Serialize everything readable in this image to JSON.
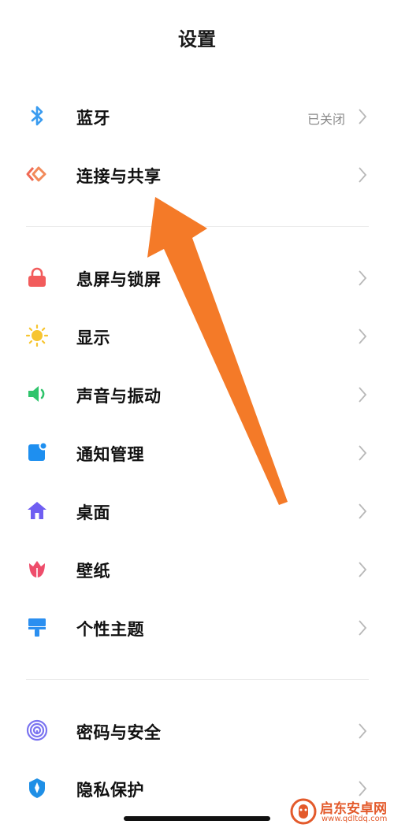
{
  "header": {
    "title": "设置"
  },
  "sections": [
    [
      {
        "id": "bluetooth",
        "label": "蓝牙",
        "value": "已关闭",
        "icon": "bluetooth-icon",
        "color": "#3a9cf0"
      },
      {
        "id": "connection",
        "label": "连接与共享",
        "value": "",
        "icon": "connection-share-icon",
        "color": "#f06a55"
      }
    ],
    [
      {
        "id": "lockscreen",
        "label": "息屏与锁屏",
        "value": "",
        "icon": "lock-icon",
        "color": "#f25c5c"
      },
      {
        "id": "display",
        "label": "显示",
        "value": "",
        "icon": "sun-icon",
        "color": "#f7c531"
      },
      {
        "id": "sound",
        "label": "声音与振动",
        "value": "",
        "icon": "speaker-icon",
        "color": "#2fc46b"
      },
      {
        "id": "notification",
        "label": "通知管理",
        "value": "",
        "icon": "notification-icon",
        "color": "#1e8ff0"
      },
      {
        "id": "desktop",
        "label": "桌面",
        "value": "",
        "icon": "home-icon",
        "color": "#6f5ef2"
      },
      {
        "id": "wallpaper",
        "label": "壁纸",
        "value": "",
        "icon": "tulip-icon",
        "color": "#ee4d6b"
      },
      {
        "id": "theme",
        "label": "个性主题",
        "value": "",
        "icon": "brush-icon",
        "color": "#2b8ff0"
      }
    ],
    [
      {
        "id": "password",
        "label": "密码与安全",
        "value": "",
        "icon": "fingerprint-icon",
        "color": "#7a73f0"
      },
      {
        "id": "privacy",
        "label": "隐私保护",
        "value": "",
        "icon": "shield-icon",
        "color": "#1f8fe6"
      }
    ]
  ],
  "annotation": {
    "color": "#f47a28",
    "icon": "arrow-icon"
  },
  "watermark": {
    "name": "启东安卓网",
    "url": "www.qdltdq.com",
    "color": "#e35a2b"
  }
}
